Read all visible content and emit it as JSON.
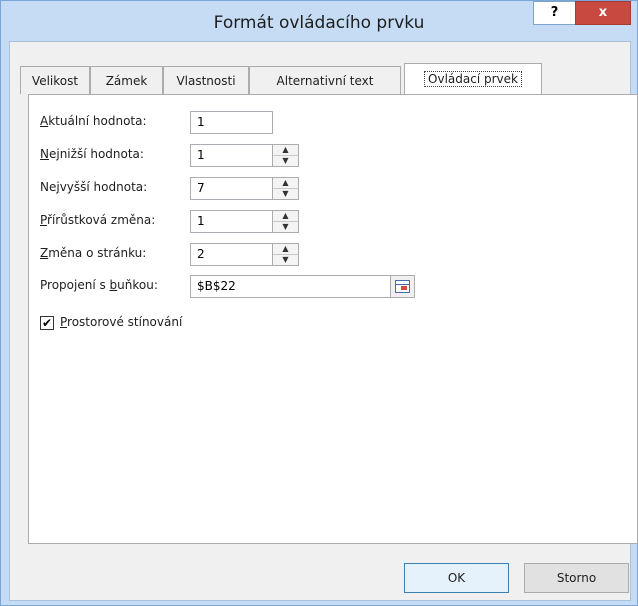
{
  "window": {
    "title": "Formát ovládacího prvku",
    "help_label": "?",
    "close_label": "x"
  },
  "tabs": [
    {
      "label": "Velikost",
      "active": false
    },
    {
      "label": "Zámek",
      "active": false
    },
    {
      "label": "Vlastnosti",
      "active": false
    },
    {
      "label": "Alternativní text",
      "active": false
    },
    {
      "label": "Ovládací prvek",
      "active": true
    }
  ],
  "fields": {
    "current_value": {
      "label_pre": "",
      "label_u": "A",
      "label_post": "ktuální hodnota:",
      "value": "1"
    },
    "min_value": {
      "label_pre": "",
      "label_u": "N",
      "label_post": "ejnižší hodnota:",
      "value": "1"
    },
    "max_value": {
      "label_pre": "Ne",
      "label_u": "j",
      "label_post": "vyšší hodnota:",
      "value": "7"
    },
    "increment": {
      "label_pre": "",
      "label_u": "P",
      "label_post": "řírůstková změna:",
      "value": "1"
    },
    "page_change": {
      "label_pre": "",
      "label_u": "Z",
      "label_post": "měna o stránku:",
      "value": "2"
    },
    "cell_link": {
      "label_pre": "Propojení s ",
      "label_u": "b",
      "label_post": "uňkou:",
      "value": "$B$22"
    }
  },
  "checkbox": {
    "checked": true,
    "check_glyph": "✔",
    "label_pre": "",
    "label_u": "P",
    "label_post": "rostorové stínování"
  },
  "buttons": {
    "ok_label": "OK",
    "cancel_label": "Storno"
  }
}
